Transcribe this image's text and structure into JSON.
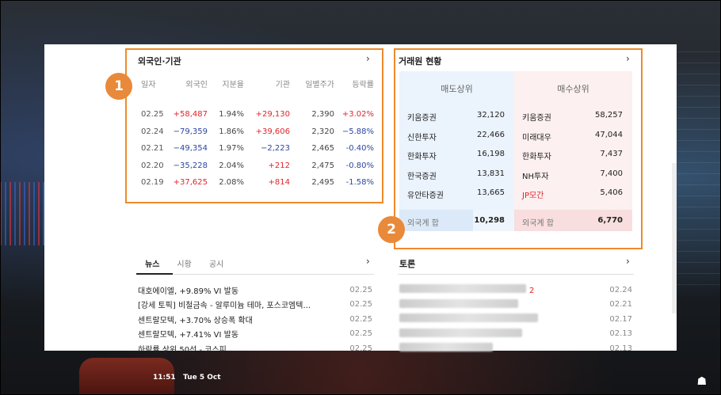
{
  "foreign_institution": {
    "title": "외국인·기관",
    "chevron": "›",
    "headers": [
      "일자",
      "외국인",
      "지분율",
      "기관",
      "일별주가",
      "등락률"
    ],
    "rows": [
      [
        "02.25",
        "+58,487",
        "1.94%",
        "+29,130",
        "2,390",
        "+3.02%"
      ],
      [
        "02.24",
        "−79,359",
        "1.86%",
        "+39,606",
        "2,320",
        "−5.88%"
      ],
      [
        "02.21",
        "−49,354",
        "1.97%",
        "−2,223",
        "2,465",
        "-0.40%"
      ],
      [
        "02.20",
        "−35,228",
        "2.04%",
        "+212",
        "2,475",
        "-0.80%"
      ],
      [
        "02.19",
        "+37,625",
        "2.08%",
        "+814",
        "2,495",
        "-1.58%"
      ]
    ]
  },
  "broker": {
    "title": "거래원 현황",
    "chevron": "›",
    "sell_header": "매도상위",
    "buy_header": "매수상위",
    "sell": [
      [
        "키움증권",
        "32,120"
      ],
      [
        "신한투자",
        "22,466"
      ],
      [
        "한화투자",
        "16,198"
      ],
      [
        "한국증권",
        "13,831"
      ],
      [
        "유안타증권",
        "13,665"
      ]
    ],
    "buy": [
      [
        "키움증권",
        "58,257"
      ],
      [
        "미래대우",
        "47,044"
      ],
      [
        "한화투자",
        "7,437"
      ],
      [
        "NH투자",
        "7,400"
      ],
      [
        "JP모간",
        "5,406"
      ]
    ],
    "sell_sum_label": "외국계 합",
    "sell_sum": "10,298",
    "buy_sum_label": "외국계 합",
    "buy_sum": "6,770"
  },
  "news": {
    "tabs": [
      "뉴스",
      "시황",
      "공시"
    ],
    "chevron": "›",
    "items": [
      [
        "대호에이엘, +9.89% VI 발동",
        "02.25"
      ],
      [
        "[강세 토픽] 비철금속 - 알루미늄 테마, 포스코엠텍...",
        "02.25"
      ],
      [
        "센트랄모텍, +3.70% 상승폭 확대",
        "02.25"
      ],
      [
        "센트랄모텍, +7.41% VI 발동",
        "02.25"
      ],
      [
        "하락률 상위 50선 - 코스피",
        "02.25"
      ]
    ]
  },
  "talk": {
    "title": "토론",
    "chevron": "›",
    "dates": [
      "02.24",
      "02.21",
      "02.17",
      "02.13",
      "02.13"
    ],
    "first_count": "2"
  },
  "badges": [
    "1",
    "2"
  ],
  "taskbar": {
    "time": "11:51",
    "date": "Tue 5 Oct"
  },
  "colors": {
    "up": "#e0252a",
    "down": "#2c46a0",
    "highlight": "#ef8a2a"
  }
}
